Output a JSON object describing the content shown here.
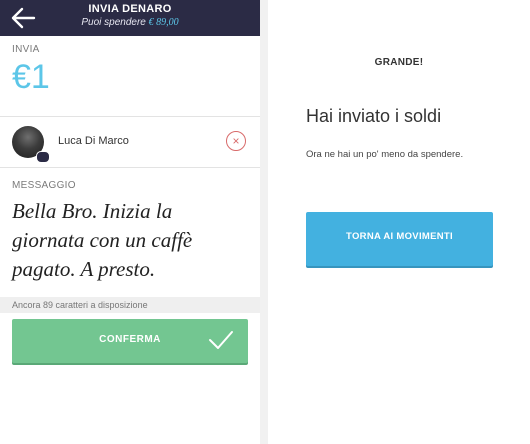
{
  "send_screen": {
    "header": {
      "title": "INVIA DENARO",
      "subtitle_prefix": "Puoi spendere",
      "balance": "€ 89,00"
    },
    "amount": {
      "label": "INVIA",
      "value": "€1"
    },
    "recipient": {
      "name": "Luca Di Marco"
    },
    "message": {
      "label": "MESSAGGIO",
      "text": "Bella Bro. Inizia la giornata con un caffè pagato. A presto."
    },
    "counter_text": "Ancora 89 caratteri a disposizione",
    "confirm_label": "CONFERMA"
  },
  "success_screen": {
    "title": "GRANDE!",
    "heading": "Hai inviato i soldi",
    "text": "Ora ne hai un po' meno da spendere.",
    "button_label": "TORNA AI MOVIMENTI"
  },
  "colors": {
    "header_bg": "#2b2b45",
    "accent_blue": "#5cc6e8",
    "confirm_green": "#73c691",
    "button_blue": "#43b1e0",
    "remove_red": "#d86a6a"
  }
}
